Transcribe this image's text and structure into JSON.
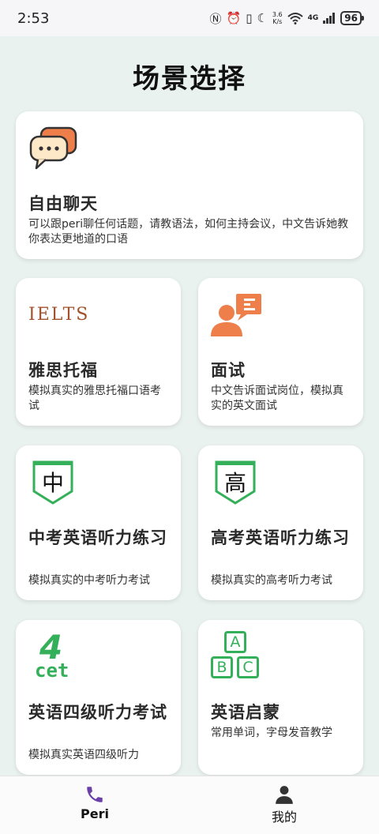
{
  "status_bar": {
    "time": "2:53",
    "net_speed_value": "3.6",
    "net_speed_unit": "K/s",
    "network": "4G",
    "battery": "96",
    "icons": [
      "nfc-icon",
      "alarm-icon",
      "vibrate-icon",
      "moon-icon",
      "wifi-icon",
      "signal-icon",
      "battery-icon"
    ]
  },
  "page": {
    "title": "场景选择"
  },
  "cards": [
    {
      "title": "自由聊天",
      "desc": "可以跟peri聊任何话题，请教语法，如何主持会议，中文告诉她教你表达更地道的口语",
      "icon": "chat-bubbles-icon"
    },
    {
      "title": "雅思托福",
      "desc": "模拟真实的雅思托福口语考试",
      "icon": "ielts-logo-icon",
      "icon_text": "IELTS"
    },
    {
      "title": "面试",
      "desc": "中文告诉面试岗位，模拟真实的英文面试",
      "icon": "interview-icon"
    },
    {
      "title": "中考英语听力练习",
      "desc": "模拟真实的中考听力考试",
      "icon": "zhong-badge-icon",
      "icon_text": "中"
    },
    {
      "title": "高考英语听力练习",
      "desc": "模拟真实的高考听力考试",
      "icon": "gao-badge-icon",
      "icon_text": "高"
    },
    {
      "title": "英语四级听力考试",
      "desc": "模拟真实英语四级听力",
      "icon": "cet4-icon",
      "icon_text_top": "4",
      "icon_text_bottom": "cet"
    },
    {
      "title": "英语启蒙",
      "desc": "常用单词，字母发音教学",
      "icon": "abc-blocks-icon",
      "icon_letters": [
        "A",
        "B",
        "C"
      ]
    }
  ],
  "bottom_nav": [
    {
      "label": "Peri",
      "icon": "phone-icon",
      "active": true
    },
    {
      "label": "我的",
      "icon": "person-icon",
      "active": false
    }
  ],
  "colors": {
    "background": "#eaf2f0",
    "accent_orange": "#ee7f4a",
    "accent_green": "#35b05a",
    "nav_active": "#6a3fa8"
  }
}
